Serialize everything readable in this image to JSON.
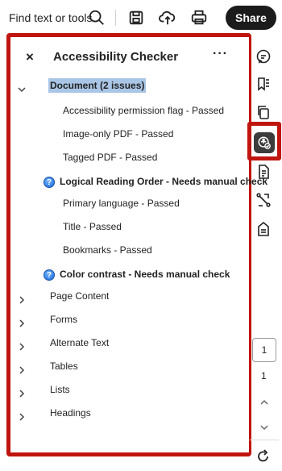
{
  "toolbar": {
    "find_text": "Find text or tools",
    "share_label": "Share",
    "icons": [
      "search-icon",
      "save-icon",
      "upload-icon",
      "print-icon"
    ]
  },
  "panel": {
    "close_glyph": "×",
    "title": "Accessibility Checker",
    "more_glyph": "···",
    "document_group": {
      "label": "Document (2 issues)",
      "items": [
        "Accessibility permission flag - Passed",
        "Image-only PDF - Passed",
        "Tagged PDF - Passed"
      ]
    },
    "reading_order": {
      "label": "Logical Reading Order - Needs manual check",
      "items": [
        "Primary language - Passed",
        "Title - Passed",
        "Bookmarks - Passed"
      ]
    },
    "color_contrast": {
      "label": "Color contrast - Needs manual check"
    },
    "collapsed_groups": [
      "Page Content",
      "Forms",
      "Alternate Text",
      "Tables",
      "Lists",
      "Headings"
    ],
    "help_glyph": "?"
  },
  "rail": {
    "icons": [
      "comment-icon",
      "bookmark-icon",
      "copy-icon",
      "accessibility-icon",
      "document-icon",
      "compare-icon",
      "export-icon"
    ],
    "page_current": "1",
    "page_total": "1"
  },
  "colors": {
    "highlight_border": "#c0150f",
    "selected_row": "#a9c6e6",
    "share_bg": "#1b1b1b"
  }
}
